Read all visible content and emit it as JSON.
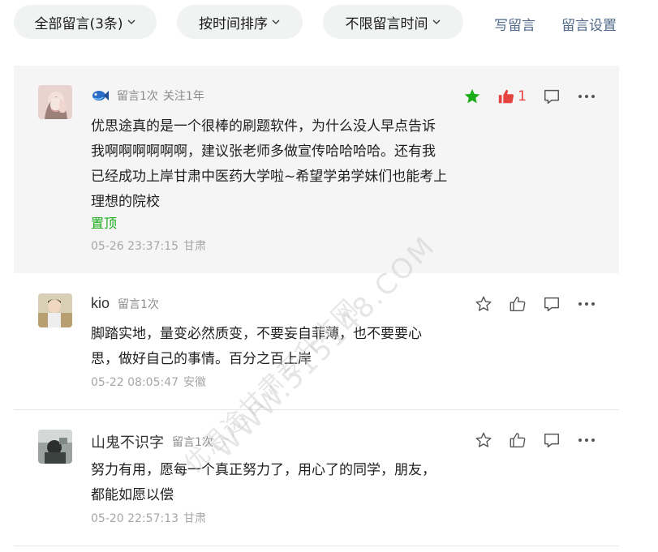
{
  "toolbar": {
    "filter_all": "全部留言(3条)",
    "sort": "按时间排序",
    "time_range": "不限留言时间",
    "write": "写留言",
    "settings": "留言设置"
  },
  "comments": [
    {
      "nickname": "",
      "badge_icon": "fish-logo-icon",
      "count_label": "留言1次",
      "follow_label": "关注1年",
      "text": "优思途真的是一个很棒的刷题软件，为什么没人早点告诉我啊啊啊啊啊啊，建议张老师多做宣传哈哈哈哈。还有我已经成功上岸甘肃中医药大学啦~希望学弟学妹们也能考上理想的院校",
      "pinned_label": "置顶",
      "time": "05-26 23:37:15",
      "location": "甘肃",
      "starred": true,
      "liked": true,
      "like_count": "1"
    },
    {
      "nickname": "kio",
      "count_label": "留言1次",
      "text": "脚踏实地，量变必然质变，不要妄自菲薄，也不要要心思，做好自己的事情。百分之百上岸",
      "time": "05-22 08:05:47",
      "location": "安徽"
    },
    {
      "nickname": "山鬼不识字",
      "count_label": "留言1次",
      "text": "努力有用，愿每一个真正努力了，用心了的同学，朋友，都能如愿以偿",
      "time": "05-20 22:57:13",
      "location": "甘肃"
    }
  ],
  "watermark": {
    "line1": "优思途甘肃专升本网",
    "line2": "WWW.515148.COM"
  },
  "colors": {
    "star_active": "#1aad19",
    "like_active": "#e64340",
    "link": "#4f6a8a"
  }
}
